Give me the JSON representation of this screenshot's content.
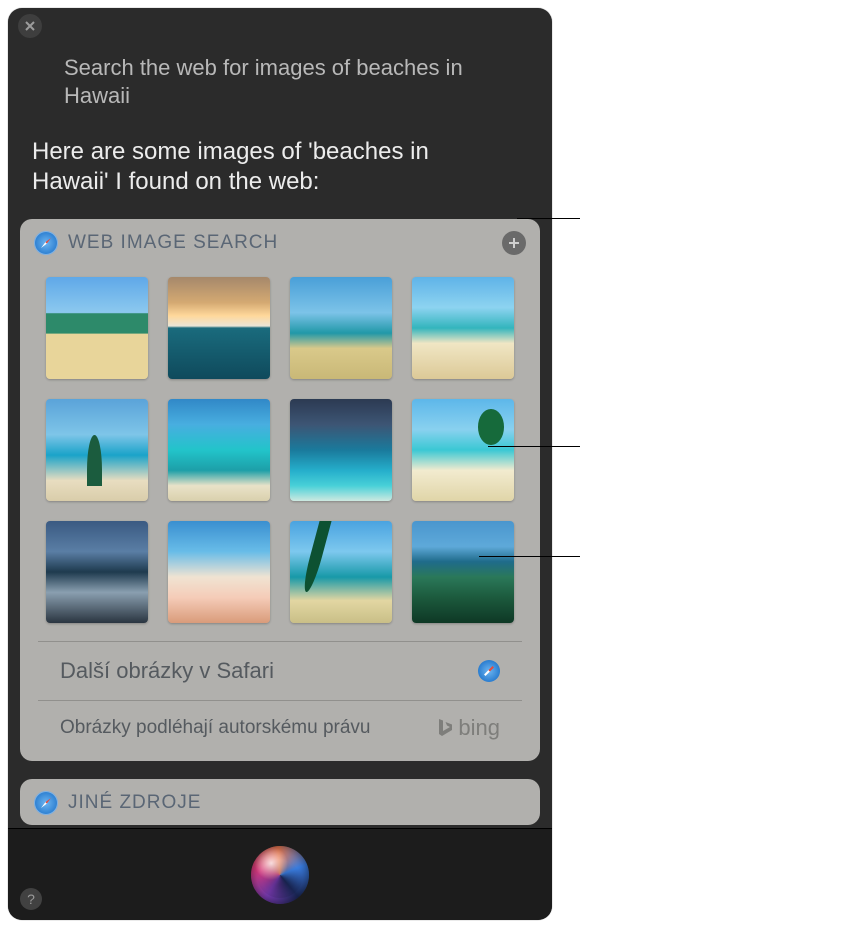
{
  "query": "Search the web for images of beaches in Hawaii",
  "response": "Here are some images of 'beaches in Hawaii' I found on the web:",
  "card": {
    "title": "WEB IMAGE SEARCH",
    "more_link": "Další obrázky v Safari",
    "copyright": "Obrázky podléhají autorskému právu",
    "provider": "bing",
    "image_count": 12
  },
  "secondary_card": {
    "title": "JINÉ ZDROJE"
  },
  "help_label": "?"
}
